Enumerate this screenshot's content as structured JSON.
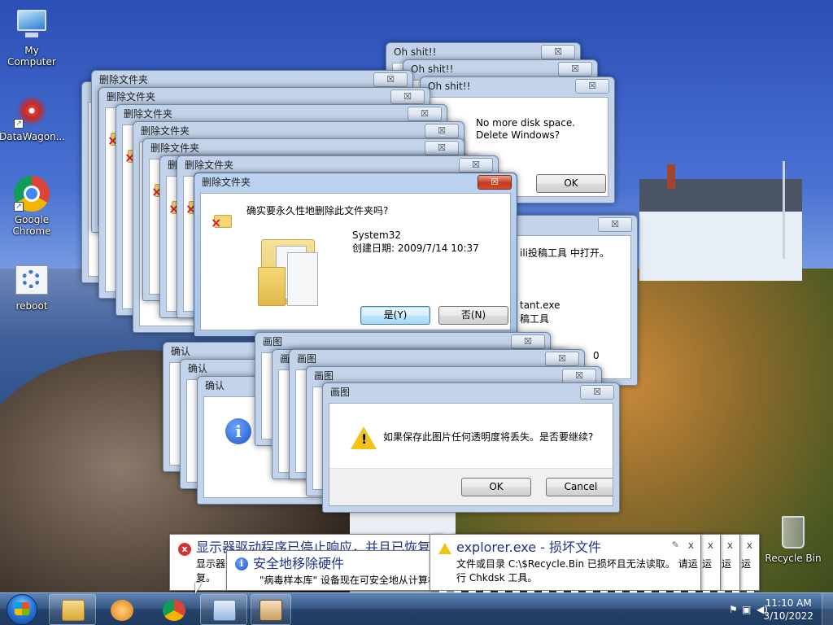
{
  "desktop": {
    "icons": [
      {
        "label": "My Computer"
      },
      {
        "label": "DataWagon..."
      },
      {
        "label": "Google\nChrome"
      },
      {
        "label": "reboot"
      },
      {
        "label": "Recycle Bin"
      }
    ]
  },
  "oh_dialogs": {
    "title": "Oh shit!!",
    "close": "☒",
    "message_line1": "No more disk space.",
    "message_line2": "Delete Windows?",
    "ok": "OK"
  },
  "delete_dialogs": {
    "title": "删除文件夹",
    "close": "☒",
    "active": {
      "question": "确实要永久性地删除此文件夹吗?",
      "folder_name": "System32",
      "created": "创建日期: 2009/7/14 10:37",
      "yes": "是(Y)",
      "no": "否(N)"
    }
  },
  "middle_dialog": {
    "line1": "ili投稿工具 中打开。",
    "line2": "tant.exe",
    "line3": "稿工具",
    "trailing": "0"
  },
  "confirm_dialogs": {
    "title": "确认",
    "info_glyph": "i"
  },
  "paint_dialogs": {
    "title": "画图",
    "close": "☒",
    "message": "如果保存此图片任何透明度将丢失。是否要继续?",
    "ok": "OK",
    "cancel": "Cancel"
  },
  "balloons": {
    "driver": {
      "title": "显示器驱动程序已停止响应，并且已恢复",
      "body1": "显示器",
      "body2": "复。"
    },
    "remove_hw": {
      "title": "安全地移除硬件",
      "body": "\"病毒样本库\" 设备现在可安全地从计算机移除。"
    },
    "explorer": {
      "title": "explorer.exe - 损坏文件",
      "body1": "文件或目录 C:\\$Recycle.Bin 已损坏且无法读取。 请运",
      "body2": "行 Chkdsk 工具。",
      "close": "x",
      "pin": "✎"
    },
    "stack": {
      "frag1": "运",
      "frag2": "运",
      "frag3": "运"
    }
  },
  "taskbar": {
    "time": "11:10 AM",
    "date": "3/10/2022"
  }
}
